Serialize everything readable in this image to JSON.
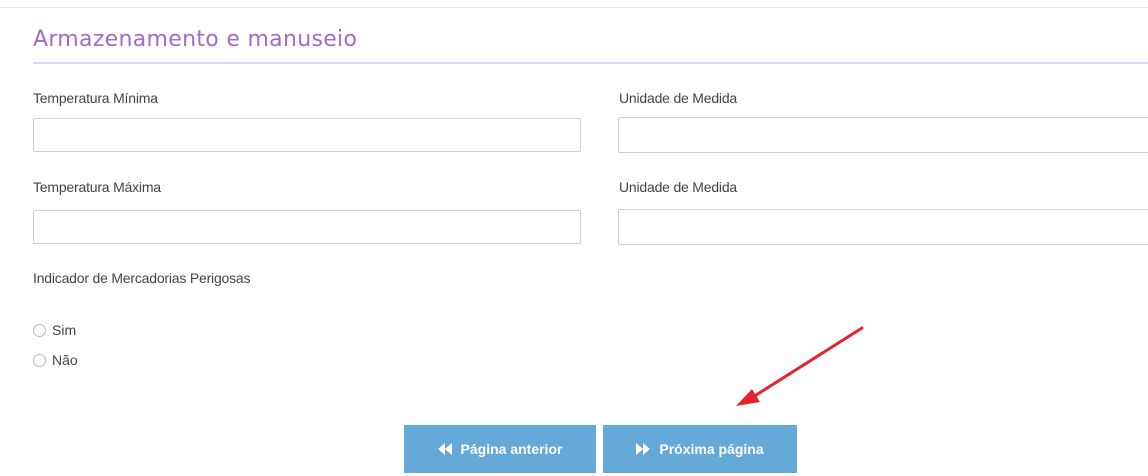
{
  "section": {
    "title": "Armazenamento e manuseio"
  },
  "fields": {
    "temp_min": {
      "label": "Temperatura Mínima",
      "value": ""
    },
    "unit_min": {
      "label": "Unidade de Medida",
      "value": ""
    },
    "temp_max": {
      "label": "Temperatura Máxima",
      "value": ""
    },
    "unit_max": {
      "label": "Unidade de Medida",
      "value": ""
    }
  },
  "dangerous_goods": {
    "label": "Indicador de Mercadorias Perigosas",
    "options": [
      {
        "label": "Sim",
        "selected": false
      },
      {
        "label": "Não",
        "selected": false
      }
    ]
  },
  "navigation": {
    "prev_label": "Página anterior",
    "next_label": "Próxima página",
    "prev_icon": "double-chevron-left-icon",
    "next_icon": "double-chevron-right-icon"
  },
  "colors": {
    "section_title": "#a06cc7",
    "button": "#65a9d8",
    "annotation_arrow": "#e8222a"
  }
}
